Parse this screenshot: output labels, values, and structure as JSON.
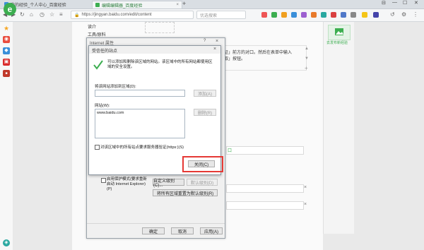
{
  "browser": {
    "tabs": [
      {
        "label": "我的经验_个人中心_百度经验",
        "close": "×"
      },
      {
        "label": "编辑编辑器_百度经验",
        "close": "×"
      }
    ],
    "new_tab": "+",
    "window_controls": [
      "⊟",
      "—",
      "☐",
      "✕"
    ],
    "url": "https://jingyan.baidu.com/edit/content",
    "search_placeholder": "优选搜索"
  },
  "page": {
    "menu_items": [
      "读介",
      "工具/原料"
    ],
    "step_text_1": "证」前方的对口。然后在表单中输入",
    "step_text_2": "取」按钮。",
    "side_controls": [
      "▲",
      "▼",
      "+"
    ],
    "right_widget_label": "去发布新经验",
    "x_marks": [
      "×",
      "×",
      "×",
      "×"
    ]
  },
  "ie_properties": {
    "title": "Internet 属性",
    "help": "?",
    "close": "×",
    "protected_mode_label": "启用保护模式(要求重新启动 Internet Explorer)(P)",
    "custom_level_button": "自定义级别(C)...",
    "default_level_button": "默认级别(D)",
    "reset_all_button": "将所有区域重置为默认级别(R)",
    "ok_button": "确定",
    "cancel_button": "取消",
    "apply_button": "应用(A)"
  },
  "trusted_sites": {
    "title": "受信任的站点",
    "close": "×",
    "description": "可以添加和删除该区域的网站。该区域中的所有网站都使用区域的安全设置。",
    "add_label": "将该网站添加到区域(D):",
    "add_value": "",
    "add_button": "添加(A)",
    "sites_label": "网站(W):",
    "sites": [
      "www.baidu.com"
    ],
    "remove_button": "删除(R)",
    "https_label": "对该区域中的所有站点要求服务器验证(https:)(S)",
    "close_button": "关闭(C)"
  },
  "colors": {
    "accent_green": "#3cae50",
    "highlight_red": "#e53935"
  }
}
